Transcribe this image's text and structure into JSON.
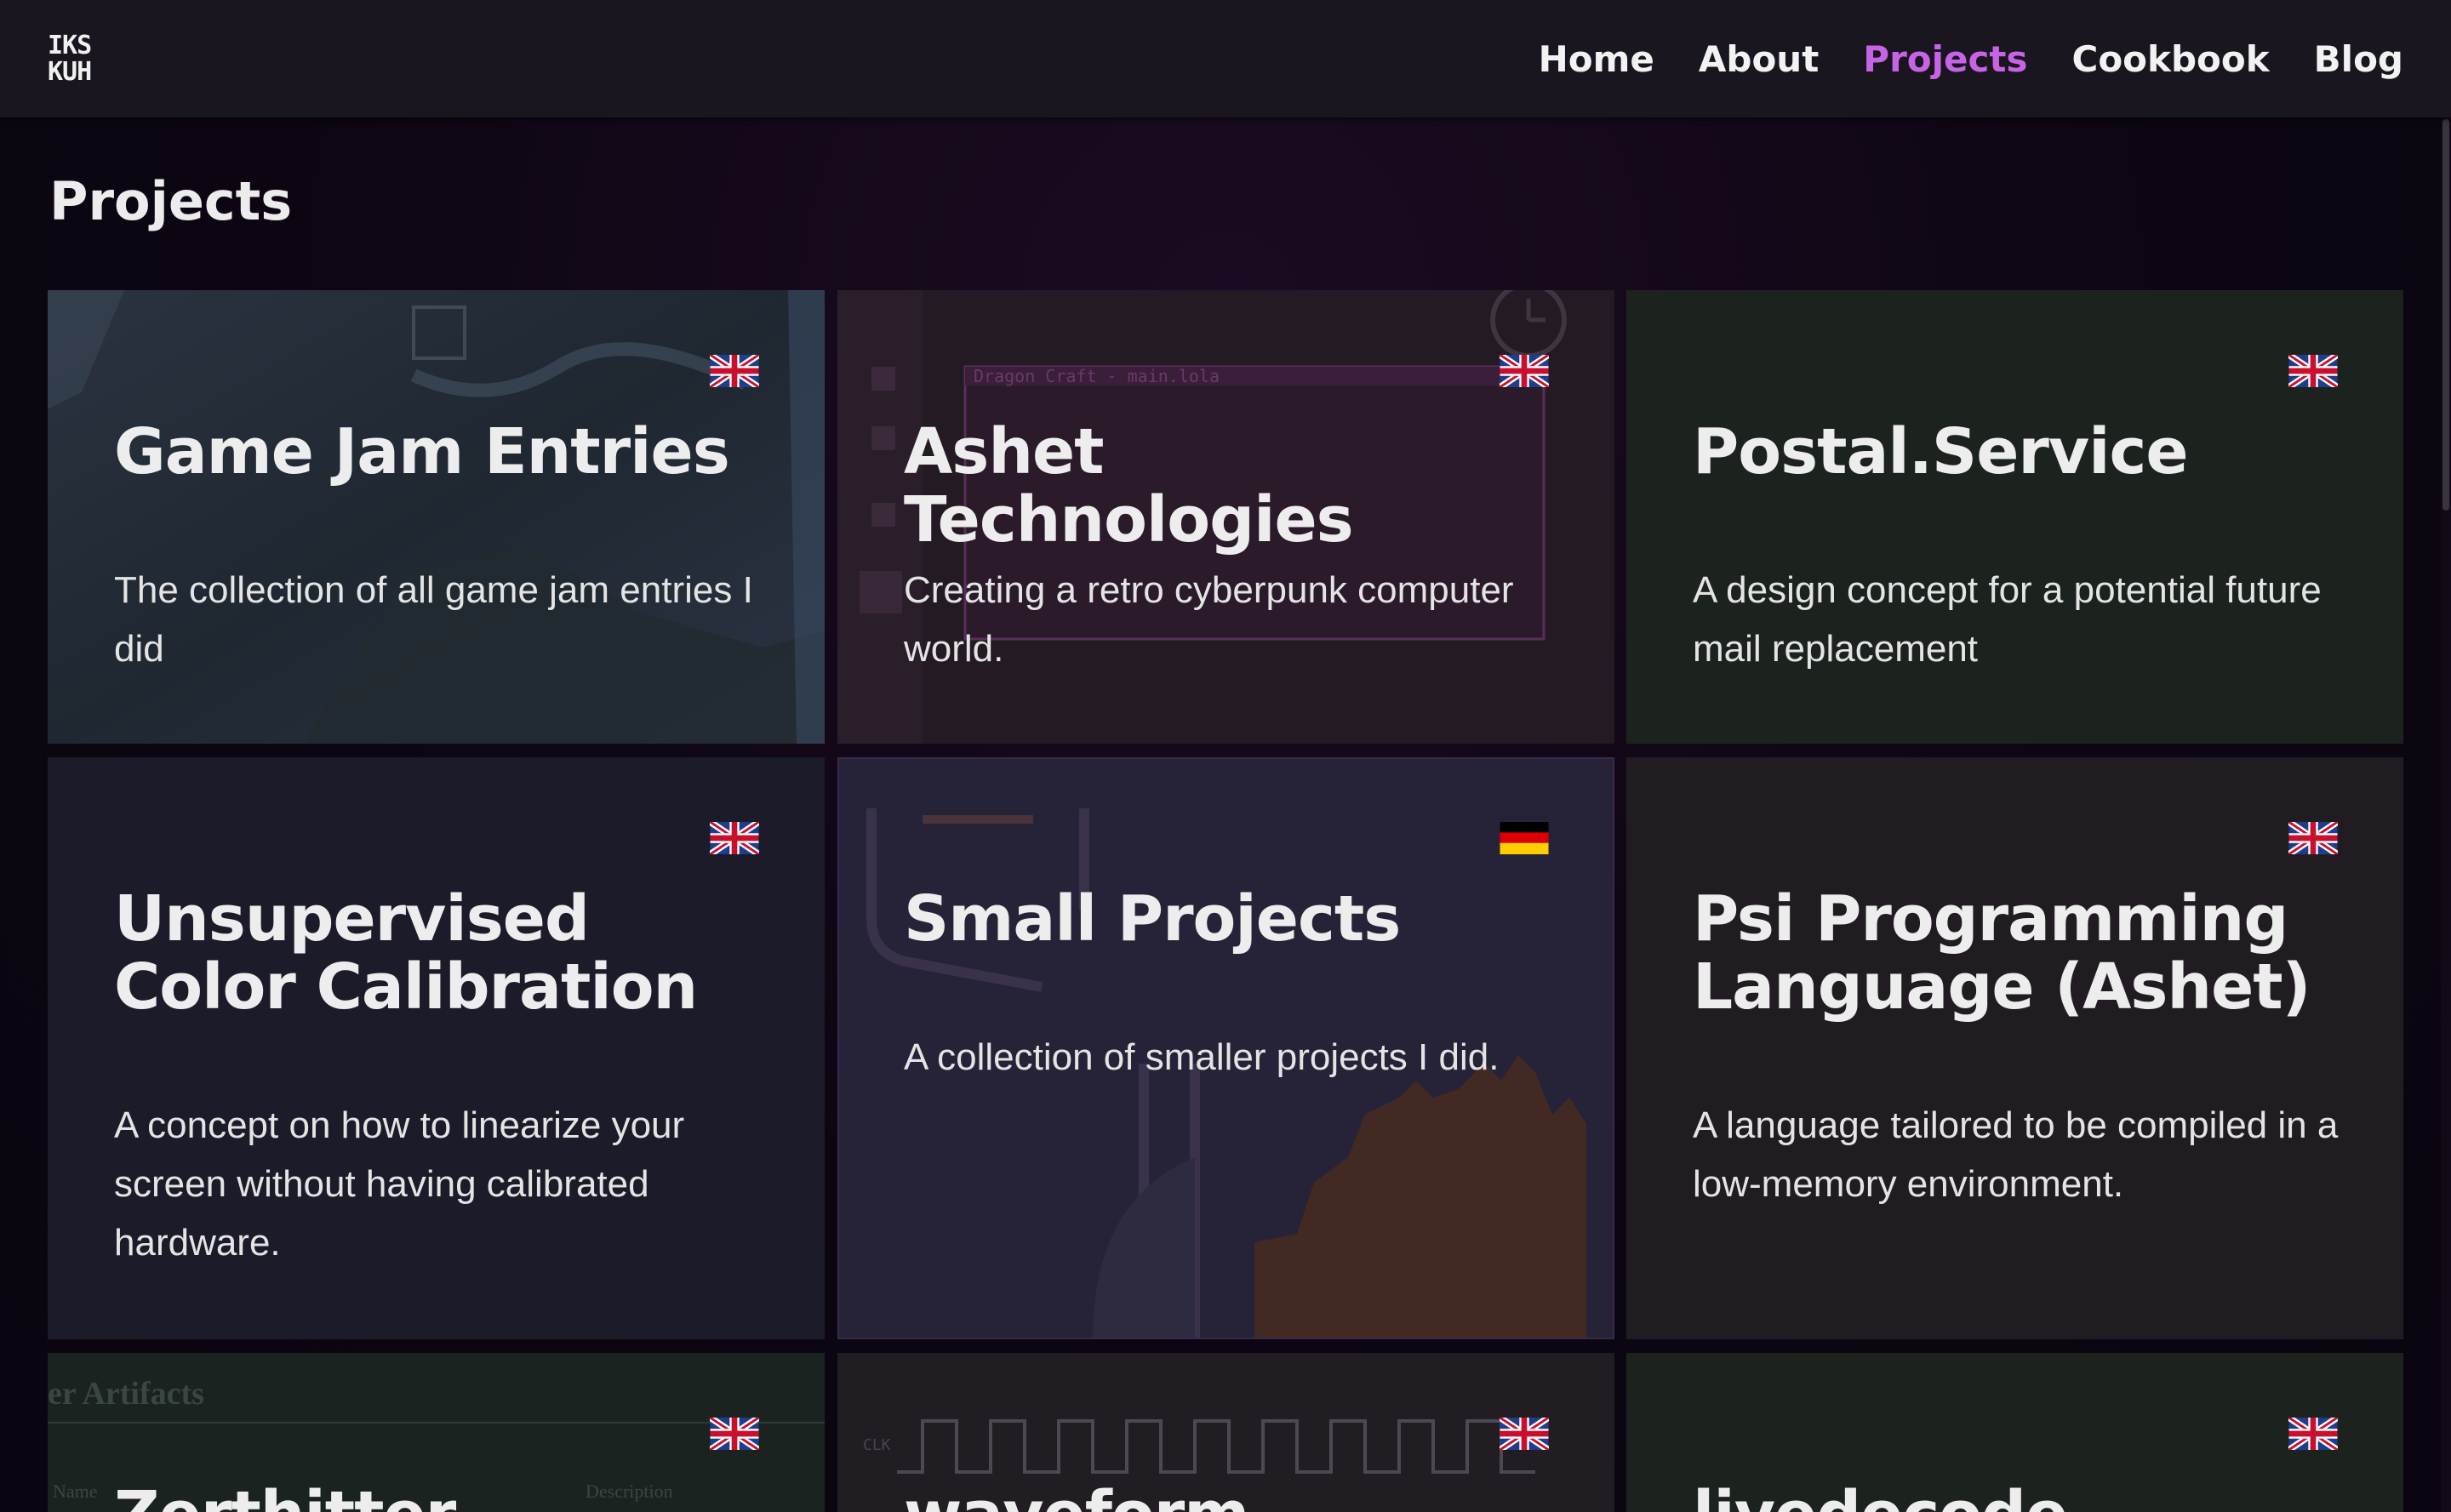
{
  "logo": {
    "line1": "IKS",
    "line2": "KUH"
  },
  "nav": {
    "items": [
      {
        "label": "Home"
      },
      {
        "label": "About"
      },
      {
        "label": "Projects",
        "active": true
      },
      {
        "label": "Cookbook"
      },
      {
        "label": "Blog"
      }
    ]
  },
  "page": {
    "title": "Projects"
  },
  "colors": {
    "accent": "#c764e6",
    "header_bg": "#1a1620",
    "page_bg": "#0d0612"
  },
  "projects": [
    {
      "title": "Game Jam Entries",
      "description": "The collection of all game jam entries I did",
      "flag": "uk-flag-icon"
    },
    {
      "title": "Ashet Technologies",
      "description": "Creating a retro cyberpunk computer world.",
      "flag": "uk-flag-icon",
      "bg_window_title": "Dragon Craft - main.lola"
    },
    {
      "title": "Postal.Service",
      "description": "A design concept for a potential future mail replacement",
      "flag": "uk-flag-icon"
    },
    {
      "title": "Unsupervised Color Calibration",
      "description": "A concept on how to linearize your screen without having calibrated hardware.",
      "flag": "uk-flag-icon"
    },
    {
      "title": "Small Projects",
      "description": "A collection of smaller projects I did.",
      "flag": "german-flag-icon"
    },
    {
      "title": "Psi Programming Language (Ashet)",
      "description": "A language tailored to be compiled in a low-memory environment.",
      "flag": "uk-flag-icon"
    },
    {
      "title": "Zerthitter",
      "description": "",
      "flag": "uk-flag-icon",
      "bg_heading": "er Artifacts",
      "bg_col1": "Name",
      "bg_col2": "Description"
    },
    {
      "title": "waveform",
      "description": "",
      "flag": "uk-flag-icon",
      "bg_clock": "CLK"
    },
    {
      "title": "livedecode",
      "description": "",
      "flag": "uk-flag-icon"
    }
  ]
}
